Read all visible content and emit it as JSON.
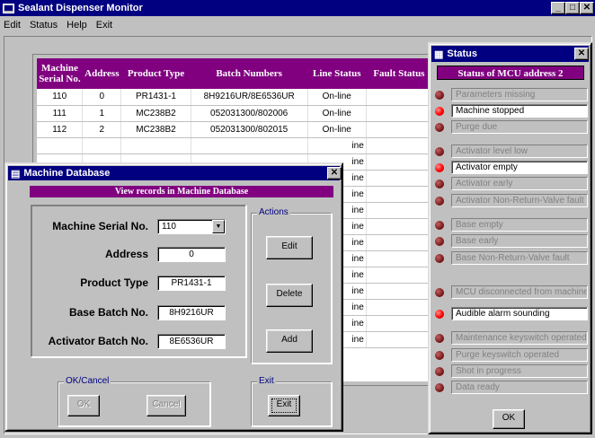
{
  "app": {
    "title": "Sealant Dispenser Monitor"
  },
  "menu": [
    "Edit",
    "Status",
    "Help",
    "Exit"
  ],
  "machine_table": {
    "headers": [
      "Machine Serial No.",
      "Address",
      "Product Type",
      "Batch Numbers",
      "Line Status",
      "Fault Status"
    ],
    "rows": [
      [
        "110",
        "0",
        "PR1431-1",
        "8H9216UR/8E6536UR",
        "On-line",
        ""
      ],
      [
        "111",
        "1",
        "MC238B2",
        "052031300/802006",
        "On-line",
        ""
      ],
      [
        "112",
        "2",
        "MC238B2",
        "052031300/802015",
        "On-line",
        ""
      ]
    ],
    "line_status_fragments": [
      "ine",
      "ine",
      "ine",
      "ine",
      "ine",
      "ine",
      "ine",
      "ine",
      "ine",
      "ine",
      "ine",
      "ine",
      "ine"
    ]
  },
  "status_window": {
    "title": "Status",
    "header": "Status of MCU address   2",
    "indicators": [
      {
        "label": "Parameters missing",
        "active": false
      },
      {
        "label": "Machine stopped",
        "active": true
      },
      {
        "label": "Purge due",
        "active": false
      },
      {
        "label": "Activator level low",
        "active": false
      },
      {
        "label": "Activator empty",
        "active": true
      },
      {
        "label": "Activator early",
        "active": false
      },
      {
        "label": "Activator Non-Return-Valve fault",
        "active": false
      },
      {
        "label": "Base empty",
        "active": false
      },
      {
        "label": "Base early",
        "active": false
      },
      {
        "label": "Base Non-Return-Valve fault",
        "active": false
      },
      {
        "label": "MCU disconnected from machine",
        "active": false
      },
      {
        "label": "Audible alarm sounding",
        "active": true
      },
      {
        "label": "Maintenance keyswitch operated",
        "active": false
      },
      {
        "label": "Purge keyswitch operated",
        "active": false
      },
      {
        "label": "Shot in progress",
        "active": false
      },
      {
        "label": "Data ready",
        "active": false
      }
    ],
    "ok_label": "OK"
  },
  "db_window": {
    "title": "Machine Database",
    "header": "View records in Machine Database",
    "fields": {
      "serial_label": "Machine Serial No.",
      "serial_value": "110",
      "address_label": "Address",
      "address_value": "0",
      "product_label": "Product Type",
      "product_value": "PR1431-1",
      "base_label": "Base Batch No.",
      "base_value": "8H9216UR",
      "activator_label": "Activator Batch No.",
      "activator_value": "8E6536UR"
    },
    "actions": {
      "group_label": "Actions",
      "edit": "Edit",
      "delete": "Delete",
      "add": "Add"
    },
    "okcancel": {
      "group_label": "OK/Cancel",
      "ok": "OK",
      "cancel": "Cancel"
    },
    "exit": {
      "group_label": "Exit",
      "exit": "Exit"
    }
  },
  "colors": {
    "title_bar": "#000080",
    "header_purple": "#800080",
    "led_active": "#ff0000",
    "led_inactive": "#a01818"
  }
}
